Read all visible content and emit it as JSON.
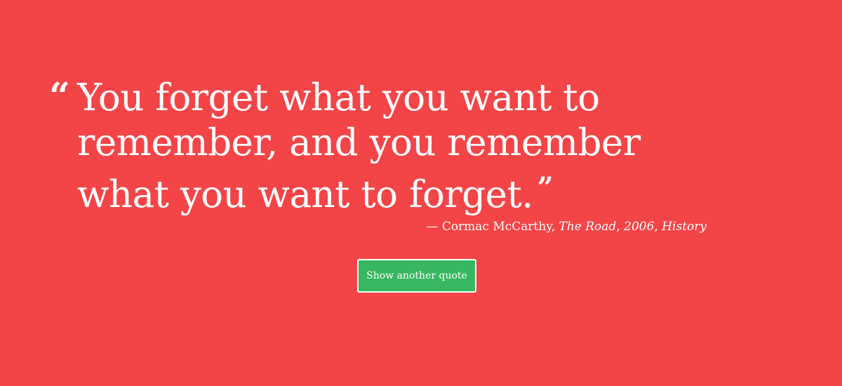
{
  "quote": {
    "open_mark": "“",
    "text": "You forget what you want to remember, and you remember what you want to forget.",
    "close_mark": "”"
  },
  "attribution": {
    "dash": "—",
    "author": "Cormac McCarthy",
    "work": "The Road",
    "year": "2006",
    "category": "History"
  },
  "button": {
    "label": "Show another quote"
  },
  "colors": {
    "background": "#f34547",
    "button": "#37b75f",
    "text": "#ffffff"
  }
}
